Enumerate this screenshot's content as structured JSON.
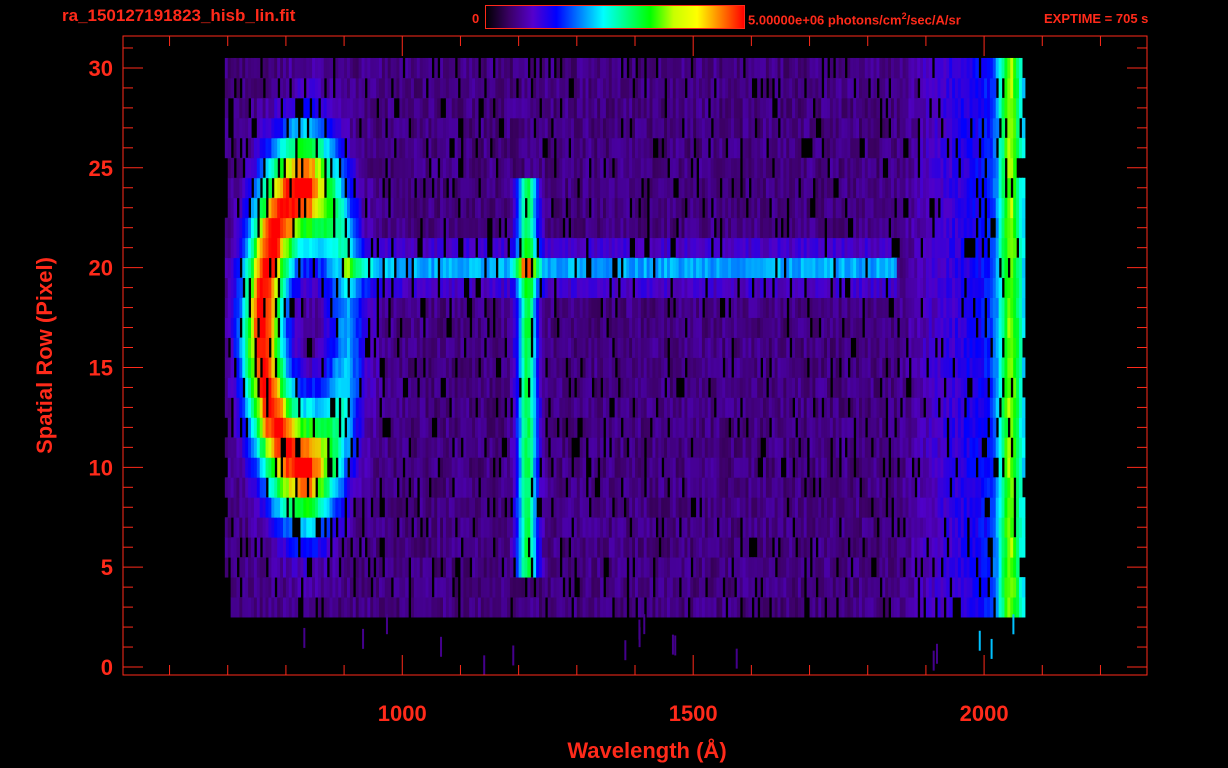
{
  "header": {
    "filename": "ra_150127191823_hisb_lin.fit",
    "scale_min": "0",
    "scale_max_pre": "5.00000e+06 photons/cm",
    "scale_max_sup": "2",
    "scale_max_post": "/sec/A/sr",
    "exptime": "EXPTIME = 705 s"
  },
  "colors": {
    "axis": "#ff2a1a",
    "background": "#000000"
  },
  "colorbar": {
    "stops": [
      "#000000",
      "#3b0066",
      "#5500cc",
      "#0000ff",
      "#0080ff",
      "#00ffff",
      "#00ff80",
      "#00ff00",
      "#c8ff00",
      "#ffff00",
      "#ff8000",
      "#ff0000"
    ]
  },
  "chart_data": {
    "type": "heatmap",
    "title": "ra_150127191823_hisb_lin.fit",
    "xlabel": "Wavelength (Å)",
    "ylabel": "Spatial Row (Pixel)",
    "xlim": [
      520,
      2280
    ],
    "ylim": [
      -0.4,
      31.6
    ],
    "xticks": [
      1000,
      1500,
      2000
    ],
    "xtick_labels": [
      "1000",
      "1500",
      "2000"
    ],
    "yticks": [
      0,
      5,
      10,
      15,
      20,
      25,
      30
    ],
    "ytick_labels": [
      "0",
      "5",
      "10",
      "15",
      "20",
      "25",
      "30"
    ],
    "color_range": [
      0,
      5000000
    ],
    "color_unit": "photons/cm^2/sec/A/sr",
    "rows": {
      "min": 3,
      "max": 30,
      "full_coverage_min": 5
    },
    "wavelength_coverage": [
      695,
      2070
    ],
    "features": [
      {
        "name": "bright arc",
        "x_range": [
          770,
          940
        ],
        "y_range": [
          10,
          24
        ],
        "peak_fraction": 1.0
      },
      {
        "name": "emission line",
        "x": 1215,
        "y_range": [
          5,
          24
        ],
        "peak_fraction": 0.6
      },
      {
        "name": "horizontal band",
        "y": 20,
        "x_range": [
          900,
          1850
        ],
        "peak_fraction": 0.45
      },
      {
        "name": "red edge",
        "x": 2050,
        "y_range": [
          3,
          30
        ],
        "peak_fraction": 0.65
      }
    ]
  }
}
